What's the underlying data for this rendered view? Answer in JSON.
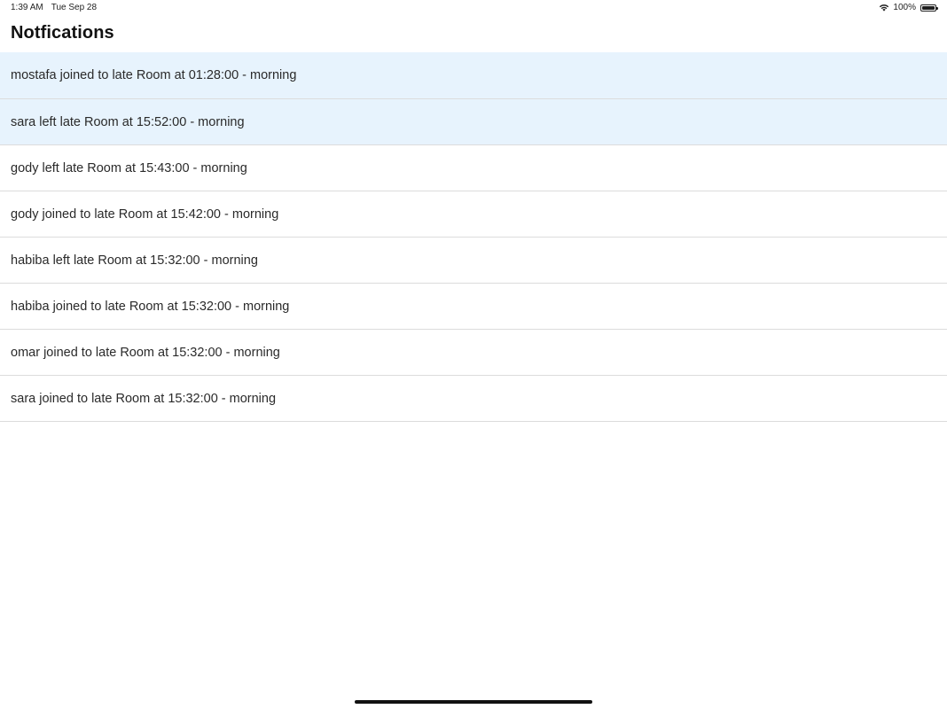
{
  "status_bar": {
    "time": "1:39 AM",
    "date": "Tue Sep 28",
    "battery_percent": "100%",
    "battery_level": 1.0,
    "wifi_icon": "wifi-icon",
    "battery_icon": "battery-icon"
  },
  "header": {
    "title": "Notfications"
  },
  "notifications": [
    {
      "text": "mostafa joined to late Room at 01:28:00 - morning",
      "unread": true
    },
    {
      "text": "sara left late Room at 15:52:00 - morning",
      "unread": true
    },
    {
      "text": "gody left late Room at 15:43:00 - morning",
      "unread": false
    },
    {
      "text": "gody joined to late Room at 15:42:00 - morning",
      "unread": false
    },
    {
      "text": "habiba left late Room at 15:32:00 - morning",
      "unread": false
    },
    {
      "text": "habiba joined to late Room at 15:32:00 - morning",
      "unread": false
    },
    {
      "text": "omar joined to late Room at 15:32:00 - morning",
      "unread": false
    },
    {
      "text": "sara joined to late Room at 15:32:00 - morning",
      "unread": false
    }
  ],
  "colors": {
    "unread_background": "#e7f3fd",
    "divider": "#dcdcdc",
    "text": "#2a2a2a"
  }
}
